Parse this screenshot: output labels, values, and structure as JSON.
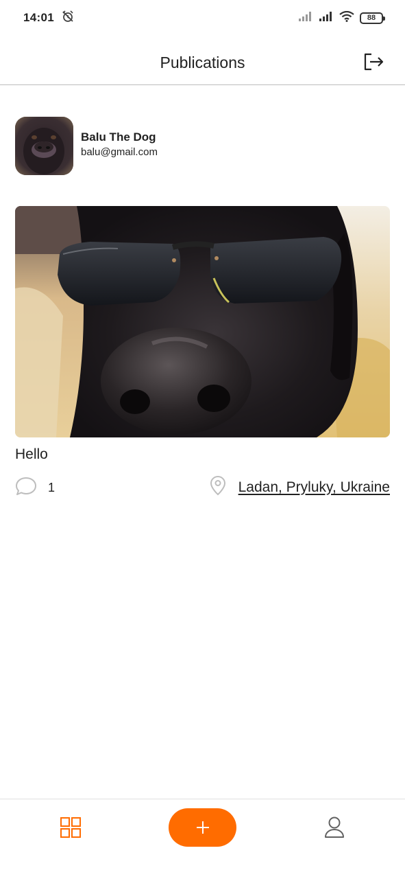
{
  "status_bar": {
    "time": "14:01",
    "battery": "88",
    "icons": [
      "alarm-off-icon",
      "signal-icon",
      "signal-icon",
      "wifi-icon",
      "battery-icon"
    ]
  },
  "header": {
    "title": "Publications",
    "logout_icon": "logout-icon"
  },
  "profile": {
    "name": "Balu The Dog",
    "email": "balu@gmail.com"
  },
  "post": {
    "title": "Hello",
    "comments_count": "1",
    "location": "Ladan, Pryluky, Ukraine",
    "comment_icon": "comment-icon",
    "location_icon": "map-pin-icon"
  },
  "bottom_nav": {
    "items": [
      "grid-icon",
      "add-icon",
      "user-icon"
    ],
    "accent_color": "#FF6C00"
  }
}
